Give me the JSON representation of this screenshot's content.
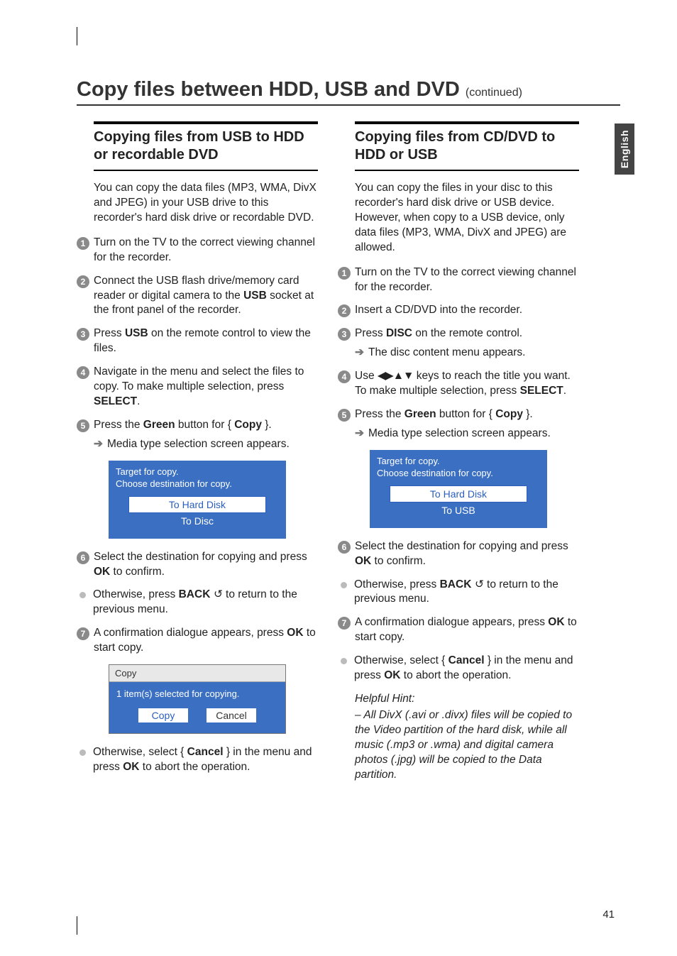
{
  "sideTab": "English",
  "pageNumber": "41",
  "title": {
    "main": "Copy files between HDD, USB and DVD",
    "cont": "(continued)"
  },
  "left": {
    "heading": "Copying files from USB to HDD or recordable DVD",
    "intro": "You can copy the data files (MP3, WMA, DivX and JPEG) in your USB drive to this recorder's hard disk drive or recordable DVD.",
    "s1": "Turn on the TV to the correct viewing channel for the recorder.",
    "s2a": "Connect the USB flash drive/memory card reader or digital camera to the ",
    "s2b": "USB",
    "s2c": " socket at the front panel of the recorder.",
    "s3a": "Press ",
    "s3b": "USB",
    "s3c": " on the remote control to view the files.",
    "s4a": "Navigate in the menu and select the files to copy.  To make multiple selection, press ",
    "s4b": "SELECT",
    "s4c": ".",
    "s5a": "Press the ",
    "s5b": "Green",
    "s5c": " button for { ",
    "s5d": "Copy",
    "s5e": " }.",
    "s5arrow": "Media type selection screen appears.",
    "blue": {
      "l1": "Target for copy.",
      "l2": "Choose destination for copy.",
      "opt1": "To Hard Disk",
      "opt2": "To Disc"
    },
    "s6a": "Select the destination for copying and press ",
    "s6b": "OK",
    "s6c": " to confirm.",
    "b1a": "Otherwise, press ",
    "b1b": "BACK",
    "b1c": " to return to the previous menu.",
    "s7a": "A confirmation dialogue appears, press ",
    "s7b": "OK",
    "s7c": " to start copy.",
    "dlg": {
      "title": "Copy",
      "msg": "1 item(s) selected for copying.",
      "btnCopy": "Copy",
      "btnCancel": "Cancel"
    },
    "b2a": "Otherwise, select { ",
    "b2b": "Cancel",
    "b2c": " } in the menu and press ",
    "b2d": "OK",
    "b2e": " to abort the operation."
  },
  "right": {
    "heading": "Copying files from CD/DVD to HDD or USB",
    "intro": "You can copy the files in your disc to this recorder's hard disk drive or USB device. However, when copy to a USB device, only data files (MP3, WMA, DivX and JPEG) are allowed.",
    "s1": "Turn on the TV to the correct viewing channel for the recorder.",
    "s2": "Insert a CD/DVD into the recorder.",
    "s3a": "Press ",
    "s3b": "DISC",
    "s3c": " on the remote control.",
    "s3arrow": "The disc content menu appears.",
    "s4a": "Use ",
    "s4b": " keys to reach the title you want. To make multiple selection, press ",
    "s4c": "SELECT",
    "s4d": ".",
    "s5a": "Press the ",
    "s5b": "Green",
    "s5c": " button for { ",
    "s5d": "Copy",
    "s5e": " }.",
    "s5arrow": "Media type selection screen appears.",
    "blue": {
      "l1": "Target for copy.",
      "l2": "Choose destination for copy.",
      "opt1": "To Hard Disk",
      "opt2": "To USB"
    },
    "s6a": "Select the destination for copying and press ",
    "s6b": "OK",
    "s6c": " to confirm.",
    "b1a": "Otherwise, press ",
    "b1b": "BACK",
    "b1c": " to return to the previous menu.",
    "s7a": "A confirmation dialogue appears, press ",
    "s7b": "OK",
    "s7c": " to start copy.",
    "b2a": "Otherwise, select { ",
    "b2b": "Cancel",
    "b2c": " } in the menu and press ",
    "b2d": "OK",
    "b2e": " to abort the operation.",
    "hintHead": "Helpful Hint:",
    "hintBody": "–  All DivX (.avi or .divx) files will be copied to the Video partition of the hard disk, while all music (.mp3 or .wma) and digital camera photos (.jpg) will be copied to the Data partition."
  }
}
